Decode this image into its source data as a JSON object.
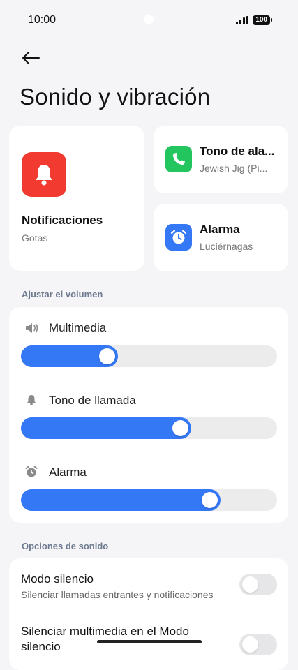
{
  "status": {
    "time": "10:00",
    "battery": "100"
  },
  "header": {
    "title": "Sonido y vibración"
  },
  "cards": {
    "notifications": {
      "title": "Notificaciones",
      "subtitle": "Gotas",
      "color": "#f23a30"
    },
    "ringtone": {
      "title": "Tono de ala...",
      "subtitle": "Jewish Jig (Pi...",
      "color": "#22c55e"
    },
    "alarm": {
      "title": "Alarma",
      "subtitle": "Luciérnagas",
      "color": "#3478f6"
    }
  },
  "volume": {
    "section_label": "Ajustar el volumen",
    "rows": [
      {
        "label": "Multimedia",
        "icon": "speaker-icon",
        "level": 0.35
      },
      {
        "label": "Tono de llamada",
        "icon": "bell-icon",
        "level": 0.65
      },
      {
        "label": "Alarma",
        "icon": "alarm-clock-icon",
        "level": 0.77
      }
    ]
  },
  "sound_options": {
    "section_label": "Opciones de sonido",
    "items": [
      {
        "title": "Modo silencio",
        "subtitle": "Silenciar llamadas entrantes y notificaciones",
        "on": false
      },
      {
        "title": "Silenciar multimedia en el Modo silencio",
        "subtitle": "",
        "on": false
      }
    ]
  },
  "colors": {
    "accent": "#3478f6",
    "background": "#f5f5f7",
    "card": "#ffffff"
  }
}
